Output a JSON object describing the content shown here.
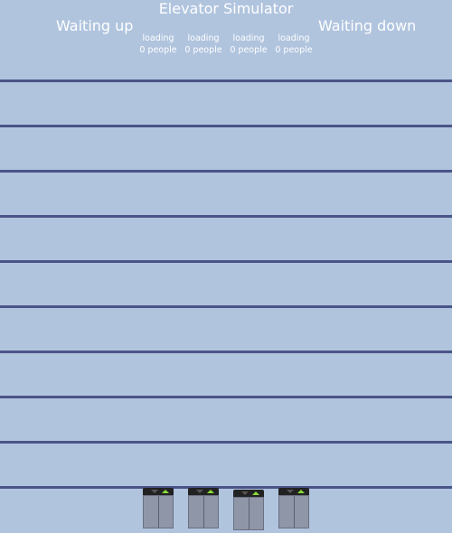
{
  "header": {
    "title": "Elevator Simulator",
    "waiting_up_label": "Waiting up",
    "waiting_down_label": "Waiting down"
  },
  "elevators": [
    {
      "state": "loading",
      "count_text": "0 people"
    },
    {
      "state": "loading",
      "count_text": "0 people"
    },
    {
      "state": "loading",
      "count_text": "0 people"
    },
    {
      "state": "loading",
      "count_text": "0 people"
    }
  ],
  "floors": {
    "count": 10
  },
  "colors": {
    "background": "#b0c4de",
    "floor_line": "#4b5488",
    "indicator_panel": "#222222",
    "up_arrow_active": "#8adb3a",
    "down_arrow_inactive": "#555555",
    "car": "#8f96a8"
  },
  "icons": [
    "down-arrow-icon",
    "up-arrow-icon"
  ]
}
